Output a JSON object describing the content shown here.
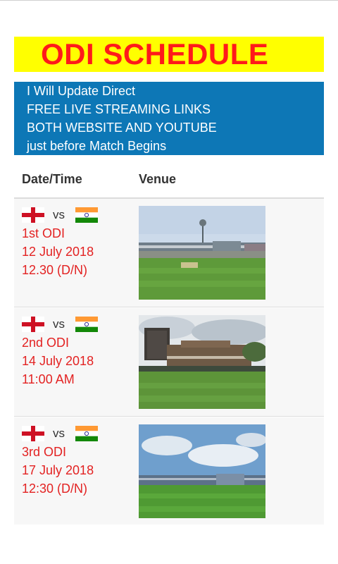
{
  "banner": {
    "title": "ODI SCHEDULE"
  },
  "info": {
    "lines": [
      "I Will Update Direct",
      "FREE LIVE STREAMING LINKS",
      "BOTH WEBSITE AND YOUTUBE",
      "just before Match Begins"
    ]
  },
  "table": {
    "headers": [
      "Date/Time",
      "Venue"
    ],
    "rows": [
      {
        "team_a_flag": "england-flag-icon",
        "vs": "vs",
        "team_b_flag": "india-flag-icon",
        "match": "1st ODI",
        "date": "12 July 2018",
        "time": "12.30 (D/N)",
        "venue_image": "stadium-photo-1"
      },
      {
        "team_a_flag": "england-flag-icon",
        "vs": "vs",
        "team_b_flag": "india-flag-icon",
        "match": "2nd ODI",
        "date": "14 July 2018",
        "time": "11:00 AM",
        "venue_image": "stadium-photo-2"
      },
      {
        "team_a_flag": "england-flag-icon",
        "vs": "vs",
        "team_b_flag": "india-flag-icon",
        "match": "3rd ODI",
        "date": "17 July 2018",
        "time": "12:30 (D/N)",
        "venue_image": "stadium-photo-3"
      }
    ]
  },
  "colors": {
    "banner_bg": "#ffff00",
    "banner_text": "#ff1a1a",
    "info_bg": "#0d77b6",
    "match_text": "#e32222"
  }
}
